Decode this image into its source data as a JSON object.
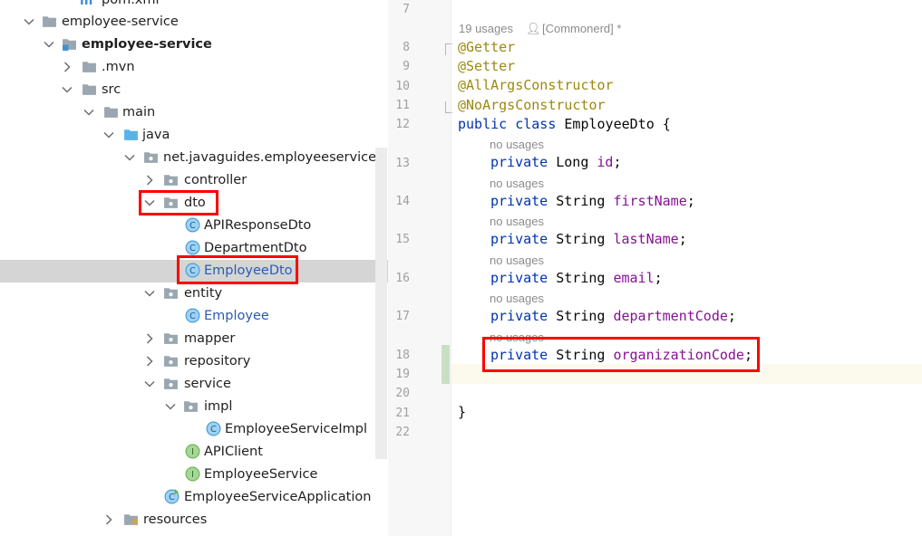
{
  "tree": {
    "items": [
      {
        "label": "pom.xml",
        "icon": "maven-file-icon"
      },
      {
        "label": "employee-service",
        "icon": "folder-icon",
        "expanded": true
      },
      {
        "label": "employee-service",
        "icon": "module-folder-icon",
        "expanded": true,
        "bold": true
      },
      {
        "label": ".mvn",
        "icon": "folder-icon",
        "expanded": false
      },
      {
        "label": "src",
        "icon": "folder-icon",
        "expanded": true
      },
      {
        "label": "main",
        "icon": "folder-icon",
        "expanded": true
      },
      {
        "label": "java",
        "icon": "source-folder-icon",
        "expanded": true
      },
      {
        "label": "net.javaguides.employeeservice",
        "icon": "package-icon",
        "expanded": true
      },
      {
        "label": "controller",
        "icon": "package-icon",
        "expanded": false
      },
      {
        "label": "dto",
        "icon": "package-icon",
        "expanded": true,
        "highlighted": true
      },
      {
        "label": "APIResponseDto",
        "icon": "class-icon"
      },
      {
        "label": "DepartmentDto",
        "icon": "class-icon"
      },
      {
        "label": "EmployeeDto",
        "icon": "class-icon",
        "selected": true,
        "highlighted": true,
        "modified": true
      },
      {
        "label": "entity",
        "icon": "package-icon",
        "expanded": true
      },
      {
        "label": "Employee",
        "icon": "class-icon",
        "modified": true
      },
      {
        "label": "mapper",
        "icon": "package-icon",
        "expanded": false
      },
      {
        "label": "repository",
        "icon": "package-icon",
        "expanded": false
      },
      {
        "label": "service",
        "icon": "package-icon",
        "expanded": true
      },
      {
        "label": "impl",
        "icon": "package-icon",
        "expanded": true
      },
      {
        "label": "EmployeeServiceImpl",
        "icon": "class-icon"
      },
      {
        "label": "APIClient",
        "icon": "interface-icon"
      },
      {
        "label": "EmployeeService",
        "icon": "interface-icon"
      },
      {
        "label": "EmployeeServiceApplication",
        "icon": "spring-boot-class-icon"
      },
      {
        "label": "resources",
        "icon": "resources-folder-icon",
        "expanded": false
      }
    ]
  },
  "editor": {
    "line_numbers": [
      "7",
      "8",
      "9",
      "10",
      "11",
      "12",
      "13",
      "14",
      "15",
      "16",
      "17",
      "18",
      "19",
      "20",
      "21",
      "22"
    ],
    "class_hint": {
      "usages": "19 usages",
      "author": "[Commonerd] *"
    },
    "field_hint": "no usages",
    "annotations": [
      "@Getter",
      "@Setter",
      "@AllArgsConstructor",
      "@NoArgsConstructor"
    ],
    "class_decl": {
      "kw1": "public",
      "kw2": "class",
      "name": "EmployeeDto",
      "brace": " {"
    },
    "fields": [
      {
        "kw": "private",
        "type": "Long",
        "name": "id"
      },
      {
        "kw": "private",
        "type": "String",
        "name": "firstName"
      },
      {
        "kw": "private",
        "type": "String",
        "name": "lastName"
      },
      {
        "kw": "private",
        "type": "String",
        "name": "email"
      },
      {
        "kw": "private",
        "type": "String",
        "name": "departmentCode"
      },
      {
        "kw": "private",
        "type": "String",
        "name": "organizationCode",
        "highlighted": true
      }
    ],
    "closing_brace": "}"
  },
  "colors": {
    "highlight": "#ff0000",
    "selection": "#d5d5d5",
    "keyword": "#0033b3",
    "annotation": "#9e880d",
    "field": "#871094"
  }
}
